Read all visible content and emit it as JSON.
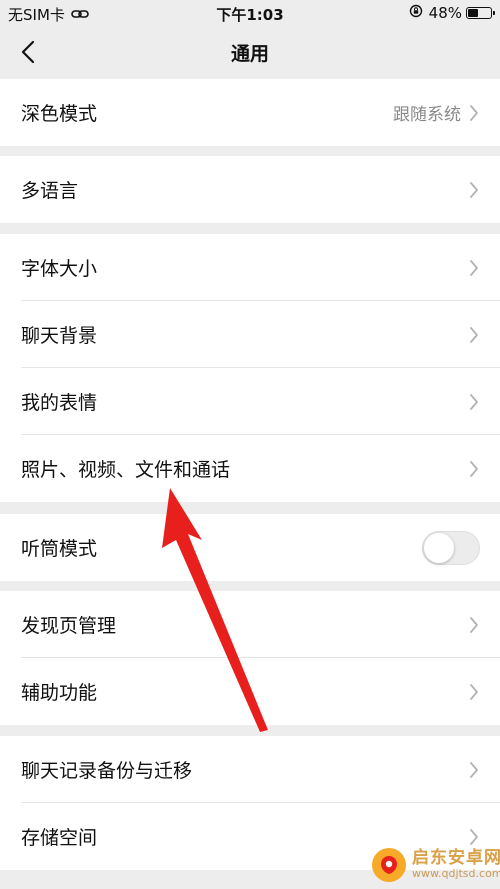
{
  "status_bar": {
    "carrier": "无SIM卡",
    "time": "下午1:03",
    "battery_text": "48%",
    "battery_level": 0.48
  },
  "nav": {
    "title": "通用"
  },
  "groups": [
    {
      "items": [
        {
          "label": "深色模式",
          "value": "跟随系统"
        }
      ]
    },
    {
      "items": [
        {
          "label": "多语言"
        }
      ]
    },
    {
      "items": [
        {
          "label": "字体大小"
        },
        {
          "label": "聊天背景"
        },
        {
          "label": "我的表情"
        },
        {
          "label": "照片、视频、文件和通话"
        }
      ]
    },
    {
      "items": [
        {
          "label": "听筒模式",
          "toggle": false
        }
      ]
    },
    {
      "items": [
        {
          "label": "发现页管理"
        },
        {
          "label": "辅助功能"
        }
      ]
    },
    {
      "items": [
        {
          "label": "聊天记录备份与迁移"
        },
        {
          "label": "存储空间"
        }
      ]
    }
  ],
  "colors": {
    "background": "#ededed",
    "arrow": "#e8201d",
    "secondary_text": "#8a8a8a"
  },
  "watermark": {
    "title": "启东安卓网",
    "url": "www.qdjtsd.com"
  }
}
